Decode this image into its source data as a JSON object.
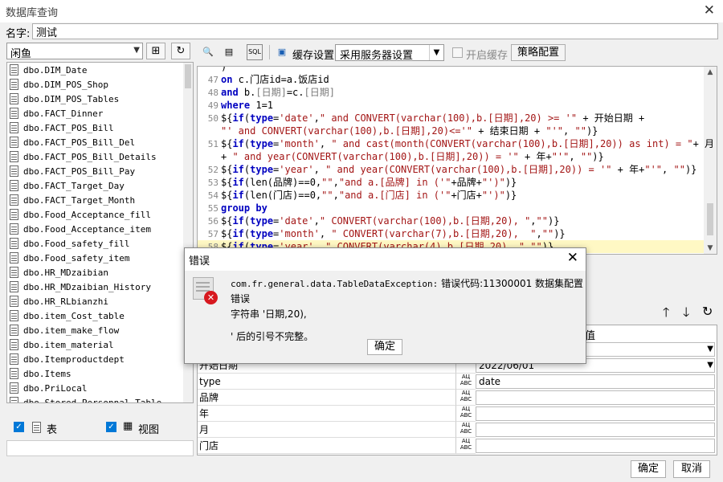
{
  "window": {
    "title": "数据库查询"
  },
  "name_row": {
    "label": "名字:",
    "value": "测试"
  },
  "left_panel": {
    "db_select": "闲鱼",
    "tables": [
      "dbo.DIM_Date",
      "dbo.DIM_POS_Shop",
      "dbo.DIM_POS_Tables",
      "dbo.FACT_Dinner",
      "dbo.FACT_POS_Bill",
      "dbo.FACT_POS_Bill_Del",
      "dbo.FACT_POS_Bill_Details",
      "dbo.FACT_POS_Bill_Pay",
      "dbo.FACT_Target_Day",
      "dbo.FACT_Target_Month",
      "dbo.Food_Acceptance_fill",
      "dbo.Food_Acceptance_item",
      "dbo.Food_safety_fill",
      "dbo.Food_safety_item",
      "dbo.HR_MDzaibian",
      "dbo.HR_MDzaibian_History",
      "dbo.HR_RLbianzhi",
      "dbo.item_Cost_table",
      "dbo.item_make_flow",
      "dbo.item_material",
      "dbo.Itemproductdept",
      "dbo.Items",
      "dbo.PriLocal",
      "dbo.Stored_Personnal_Table"
    ],
    "check_table": "表",
    "check_view": "视图"
  },
  "toolbar": {
    "cache_settings": "缓存设置",
    "server_setting": "采用服务器设置",
    "enable_cache": "开启缓存",
    "strategy_config": "策略配置",
    "sql_icon": "SQL"
  },
  "editor": {
    "lines": [
      {
        "n": "47",
        "html": "<span class='kw'>on</span> c.门店id=a.饭店id"
      },
      {
        "n": "48",
        "html": "<span class='kw'>and</span> b.<span class='fld'>[日期]</span>=c.<span class='fld'>[日期]</span>"
      },
      {
        "n": "49",
        "html": "<span class='kw'>where</span> 1=1"
      },
      {
        "n": "50",
        "html": "${<span class='kw'>if</span>(<span class='kw'>type</span>=<span class='str'>'date'</span>,<span class='str'>\" and CONVERT(varchar(100),b.[日期],20) >= '\"</span> + 开始日期 +"
      },
      {
        "n": "",
        "html": "<span class='str'>\"' and CONVERT(varchar(100),b.[日期],20)<='\"</span> + 结束日期 + <span class='str'>\"'\"</span>, <span class='str'>\"\"</span>)}"
      },
      {
        "n": "51",
        "html": "${<span class='kw'>if</span>(<span class='kw'>type</span>=<span class='str'>'month'</span>, <span class='str'>\" and cast(month(CONVERT(varchar(100),b.[日期],20)) as int) = \"</span>+ 月"
      },
      {
        "n": "",
        "html": "+ <span class='str'>\" and year(CONVERT(varchar(100),b.[日期],20)) = '\"</span> + 年+<span class='str'>\"'\"</span>, <span class='str'>\"\"</span>)}"
      },
      {
        "n": "52",
        "html": "${<span class='kw'>if</span>(<span class='kw'>type</span>=<span class='str'>'year'</span>, <span class='str'>\" and year(CONVERT(varchar(100),b.[日期],20)) = '\"</span> + 年+<span class='str'>\"'\"</span>, <span class='str'>\"\"</span>)}"
      },
      {
        "n": "53",
        "html": "${<span class='kw'>if</span>(len(品牌)==0,<span class='str'>\"\"</span>,<span class='str'>\"and a.[品牌] in ('\"</span>+品牌+<span class='str'>\"')\"</span>)}"
      },
      {
        "n": "54",
        "html": "${<span class='kw'>if</span>(len(门店)==0,<span class='str'>\"\"</span>,<span class='str'>\"and a.[门店] in ('\"</span>+门店+<span class='str'>\"')\"</span>)}"
      },
      {
        "n": "55",
        "html": "<span class='kw'>group by</span>"
      },
      {
        "n": "56",
        "html": "${<span class='kw'>if</span>(<span class='kw'>type</span>=<span class='str'>'date'</span>,<span class='str'>\" CONVERT(varchar(100),b.[日期,20), \"</span>,<span class='str'>\"\"</span>)}"
      },
      {
        "n": "57",
        "html": "${<span class='kw'>if</span>(<span class='kw'>type</span>=<span class='str'>'month'</span>, <span class='str'>\" CONVERT(varchar(7),b.[日期,20),  \"</span>,<span class='str'>\"\"</span>)}"
      },
      {
        "n": "58",
        "html": "${<span class='kw'>if</span>(<span class='kw'>type</span>=<span class='str'>'year'</span>, <span class='str'>\" CONVERT(varchar(4),b.[日期,20), \"</span>,<span class='str'>\"\"</span>)}"
      }
    ]
  },
  "params": {
    "header_value": "值",
    "rows": [
      {
        "name": "",
        "value": "",
        "dropdown": true
      },
      {
        "name": "开始日期",
        "value": "2022/06/01",
        "dropdown": true
      },
      {
        "name": "type",
        "value": "date",
        "dropdown": false
      },
      {
        "name": "品牌",
        "value": "",
        "dropdown": false
      },
      {
        "name": "年",
        "value": "",
        "dropdown": false
      },
      {
        "name": "月",
        "value": "",
        "dropdown": false
      },
      {
        "name": "门店",
        "value": "",
        "dropdown": false
      }
    ]
  },
  "footer": {
    "ok": "确定",
    "cancel": "取消"
  },
  "error_dialog": {
    "title": "错误",
    "message_line1_code": "com.fr.general.data.TableDataException:",
    "message_line1_text": " 错误代码:11300001 数据集配置错误",
    "message_line2": "字符串 '日期,20),",
    "message_line3": "' 后的引号不完整。",
    "ok": "确定"
  }
}
